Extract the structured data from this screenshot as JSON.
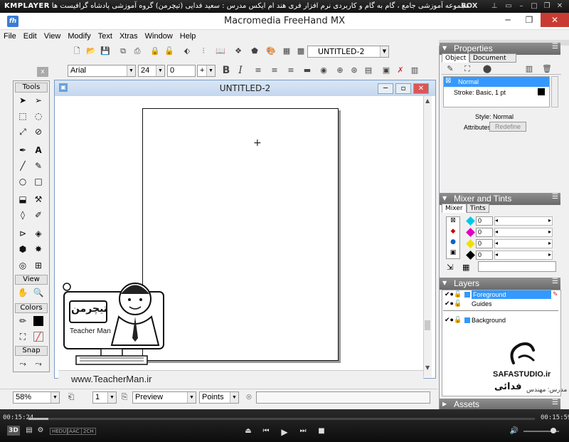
{
  "player": {
    "logo": "KMPLAYER",
    "title": "مجموعه آموزشی جامع ، گام به گام و کاربردی نرم افزار فری هند ام ایکس   مدرس : سعید فدایی (تیچرمن) گروه آموزشی پادشاه گرافیست ها",
    "box_label": "BOX",
    "time_elapsed": "00:15:24",
    "time_total": "00:15:59",
    "elapsed_fraction": 0.04,
    "bottom_badges": [
      "HEDU",
      "AAC",
      "2CH"
    ],
    "badge_3d": "3D"
  },
  "app": {
    "title": "Macromedia FreeHand MX",
    "icon_letter": "fh",
    "menu": [
      "File",
      "Edit",
      "View",
      "Modify",
      "Text",
      "Xtras",
      "Window",
      "Help"
    ]
  },
  "toolbar": {
    "document_select": "UNTITLED-2",
    "font": "Arial",
    "font_size": "24",
    "leading": "0",
    "leading_mode": "+"
  },
  "tools": {
    "sections": [
      "Tools",
      "View",
      "Colors",
      "Snap"
    ]
  },
  "document": {
    "title": "UNTITLED-2"
  },
  "status": {
    "zoom": "58%",
    "page": "1",
    "view_mode": "Preview",
    "units": "Points"
  },
  "properties": {
    "header": "Properties",
    "tabs": [
      "Object",
      "Document"
    ],
    "items": [
      "Normal",
      "Stroke: Basic, 1 pt"
    ],
    "style_label": "Style: Normal",
    "attributes_label": "Attributes:",
    "redefine_button": "Redefine"
  },
  "mixer": {
    "header": "Mixer and Tints",
    "tabs": [
      "Mixer",
      "Tints"
    ],
    "values": [
      "0",
      "0",
      "0",
      "0"
    ],
    "swatch_colors": [
      "#00c8e8",
      "#e000c0",
      "#f0e000",
      "#000000"
    ]
  },
  "layers": {
    "header": "Layers",
    "items": [
      "Foreground",
      "Guides",
      "Background"
    ]
  },
  "assets": {
    "header": "Assets"
  },
  "watermark": {
    "site": "SAFASTUDIO.ir",
    "teacher_url": "www.TeacherMan.ir",
    "teacher_name": "Teacher Man",
    "persian_brand": "تیچرمن",
    "instructor_label": "مدرس: مهندس",
    "instructor_name": "فدائی"
  }
}
